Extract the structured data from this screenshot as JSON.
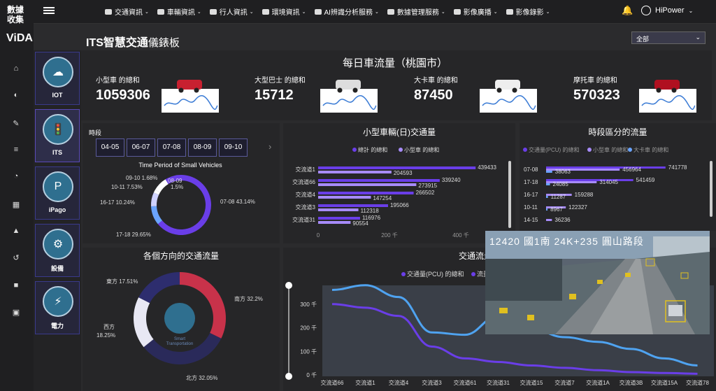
{
  "brand": {
    "zh": "數據收集",
    "name": "ViDA"
  },
  "nav": [
    {
      "label": "交通資訊",
      "icon": "traffic-icon"
    },
    {
      "label": "車輛資訊",
      "icon": "car-icon"
    },
    {
      "label": "行人資訊",
      "icon": "pedestrian-icon"
    },
    {
      "label": "環境資訊",
      "icon": "environment-icon"
    },
    {
      "label": "AI辨識分析服務",
      "icon": "ai-icon"
    },
    {
      "label": "數據管理服務",
      "icon": "data-icon"
    },
    {
      "label": "影像廣播",
      "icon": "broadcast-icon"
    },
    {
      "label": "影像錄影",
      "icon": "record-icon"
    }
  ],
  "user": {
    "name": "HiPower"
  },
  "modules": [
    {
      "label": "IOT",
      "icon": "iot-icon"
    },
    {
      "label": "ITS",
      "icon": "traffic-light-icon"
    },
    {
      "label": "iPago",
      "icon": "parking-icon"
    },
    {
      "label": "設備",
      "icon": "device-icon"
    },
    {
      "label": "電力",
      "icon": "power-icon"
    }
  ],
  "page": {
    "title": "ITS智慧交通",
    "title_suffix": "儀錶板",
    "filter": "全部"
  },
  "daily": {
    "title": "每日車流量（桃園市）"
  },
  "kpis": [
    {
      "name": "小型車 的總和",
      "value": "1059306"
    },
    {
      "name": "大型巴士 的總和",
      "value": "15712"
    },
    {
      "name": "大卡車 的總和",
      "value": "87450"
    },
    {
      "name": "摩托車 的總和",
      "value": "570323"
    }
  ],
  "period": {
    "label": "時段",
    "tabs": [
      "04-05",
      "06-07",
      "07-08",
      "08-09",
      "09-10"
    ],
    "more": "›"
  },
  "chart_data": [
    {
      "type": "pie",
      "title": "Time Period of Small Vehicles",
      "categories": [
        "07-08",
        "17-18",
        "16-17",
        "10-11",
        "09-10",
        "08-09"
      ],
      "values": [
        43.14,
        29.65,
        10.24,
        7.53,
        1.68,
        7.76
      ],
      "labels": [
        "07-08 43.14%",
        "17-18 29.65%",
        "16-17 10.24%",
        "10-11 7.53%",
        "09-10 1.68%",
        "08-09",
        "1.5%"
      ],
      "colors": [
        "#6a3ee8",
        "#6a3ee8",
        "#6aa4ff",
        "#cfd2ff",
        "#ffffff",
        "#ffffff"
      ]
    },
    {
      "type": "bar",
      "title": "小型車輛(日)交通量",
      "legend": [
        "總計 的總和",
        "小型車 的總和"
      ],
      "categories": [
        "交流道1",
        "交流道66",
        "交流道4",
        "交流道3",
        "交流道31"
      ],
      "series": [
        {
          "name": "總計 的總和",
          "values": [
            439433,
            339240,
            266502,
            195066,
            116976
          ]
        },
        {
          "name": "小型車 的總和",
          "values": [
            204593,
            273915,
            147254,
            112318,
            90554
          ]
        }
      ],
      "xticks": [
        "0",
        "200 千",
        "400 千"
      ],
      "xlim": [
        0,
        400000
      ]
    },
    {
      "type": "bar",
      "title": "時段區分的流量",
      "legend": [
        "交通量(PCU) 的總和",
        "小型車 的總和",
        "大卡車 的總和"
      ],
      "categories": [
        "07-08",
        "17-18",
        "16-17",
        "10-11",
        "14-15"
      ],
      "series": [
        {
          "name": "交通量(PCU) 的總和",
          "values": [
            741778,
            541459,
            null,
            null,
            null
          ]
        },
        {
          "name": "小型車 的總和",
          "values": [
            456964,
            314045,
            159288,
            122327,
            36236
          ]
        },
        {
          "name": "大卡車 的總和",
          "values": [
            38063,
            24085,
            11287,
            8967,
            null
          ]
        }
      ]
    },
    {
      "type": "pie",
      "title": "各個方向的交通流量",
      "categories": [
        "南方",
        "北方",
        "西方",
        "東方"
      ],
      "values": [
        32.2,
        32.05,
        18.25,
        17.51
      ],
      "labels": [
        "南方 32.2%",
        "北方 32.05%",
        "西方\n18.25%",
        "東方 17.51%"
      ],
      "colors": [
        "#c8324a",
        "#2a2a5a",
        "#e8e8f4",
        "#2d2d6e"
      ],
      "center": "Smart Transportation"
    },
    {
      "type": "line",
      "title": "交通流量",
      "legend": [
        "交通量(PCU) 的總和",
        "流量"
      ],
      "categories": [
        "交流道66",
        "交流道1",
        "交流道4",
        "交流道3",
        "交流道61",
        "交流道31",
        "交流道15",
        "交流道7",
        "交流道1A",
        "交流道3B",
        "交流道15A",
        "交流道78"
      ],
      "series": [
        {
          "name": "交通量(PCU) 的總和",
          "values": [
            360,
            380,
            330,
            180,
            170,
            250,
            195,
            160,
            140,
            110,
            70,
            40
          ]
        },
        {
          "name": "流量",
          "values": [
            300,
            285,
            250,
            120,
            70,
            55,
            40,
            30,
            20,
            12,
            8,
            5
          ]
        }
      ],
      "yticks": [
        "0 千",
        "100 千",
        "200 千",
        "300 千"
      ],
      "ylim": [
        0,
        400
      ]
    }
  ],
  "video": {
    "caption": "12420  國1南  24K+235  圓山路段"
  }
}
